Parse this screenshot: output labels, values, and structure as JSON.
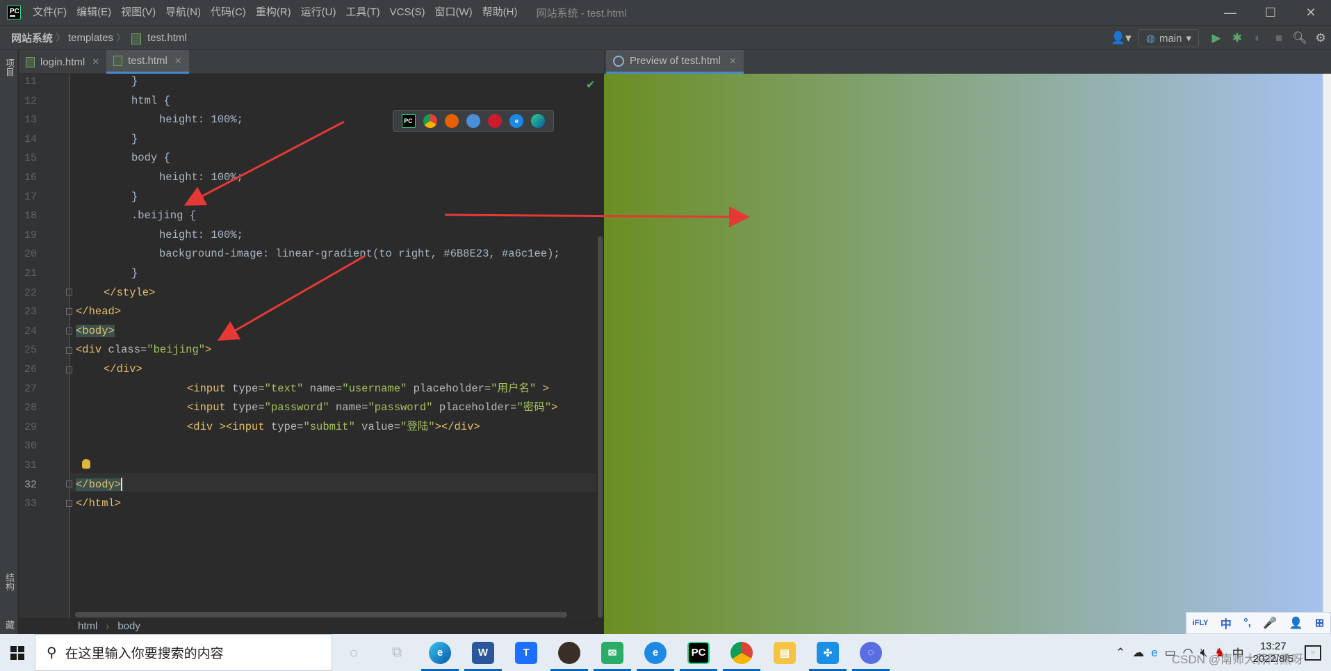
{
  "titlebar": {
    "menu": [
      "文件(F)",
      "编辑(E)",
      "视图(V)",
      "导航(N)",
      "代码(C)",
      "重构(R)",
      "运行(U)",
      "工具(T)",
      "VCS(S)",
      "窗口(W)",
      "帮助(H)"
    ],
    "window_title": "网站系统 - test.html",
    "logo_text": "PC"
  },
  "navbar": {
    "project": "网站系统",
    "folder": "templates",
    "file": "test.html",
    "run_config": "main"
  },
  "left_strip": {
    "project_label": "项目",
    "structure_label": "结构",
    "bookmarks_label": "收藏"
  },
  "editor": {
    "tabs": [
      {
        "label": "login.html",
        "active": false
      },
      {
        "label": "test.html",
        "active": true
      }
    ],
    "current_line": 32,
    "line_numbers": [
      "11",
      "12",
      "13",
      "14",
      "15",
      "16",
      "17",
      "18",
      "19",
      "20",
      "21",
      "22",
      "23",
      "24",
      "25",
      "26",
      "27",
      "28",
      "29",
      "30",
      "31",
      "32",
      "33"
    ],
    "lines": {
      "l11": "}",
      "l12": "html {",
      "l13": "height: 100%;",
      "l14": "}",
      "l15": "body {",
      "l16": "height: 100%;",
      "l17": "}",
      "l18": ".beijing {",
      "l19": "height: 100%;",
      "l20": "background-image: linear-gradient(to right, #6B8E23, #a6c1ee);",
      "l21": "}",
      "l22": "</style>",
      "l23": "</head>",
      "l24": "<body>",
      "l25_tag": "<div ",
      "l25_attr": "class=",
      "l25_val": "\"beijing\"",
      "l25_end": ">",
      "l26": "</div>",
      "l27_tag": "<input ",
      "l27_a1": "type=",
      "l27_v1": "\"text\" ",
      "l27_a2": "name=",
      "l27_v2": "\"username\" ",
      "l27_a3": "placeholder=",
      "l27_v3": "\"用户名\" ",
      "l27_end": ">",
      "l28_tag": "<input ",
      "l28_a1": "type=",
      "l28_v1": "\"password\" ",
      "l28_a2": "name=",
      "l28_v2": "\"password\" ",
      "l28_a3": "placeholder=",
      "l28_v3": "\"密码\"",
      "l28_end": ">",
      "l29_tag1": "<div >",
      "l29_tag2": "<input ",
      "l29_a1": "type=",
      "l29_v1": "\"submit\" ",
      "l29_a2": "value=",
      "l29_v2": "\"登陆\"",
      "l29_end": "></div>",
      "l32": "</body>",
      "l33": "</html>"
    },
    "browsers": [
      "PC",
      "C",
      "F",
      "S",
      "O",
      "e",
      "E"
    ],
    "bottom_crumbs": [
      "html",
      "body"
    ]
  },
  "preview": {
    "tab_label": "Preview of test.html",
    "gradient_from": "#6B8E23",
    "gradient_to": "#a6c1ee"
  },
  "ime": [
    "iFLY",
    "中",
    "°,",
    "🎤",
    "👤",
    "⊞"
  ],
  "taskbar": {
    "search_placeholder": "在这里输入你要搜索的内容",
    "time": "13:27",
    "date": "2022/8/5",
    "watermark": "CSDN @南师大蒜阿熏呀"
  },
  "colors": {
    "editor_bg": "#2b2b2b",
    "tag": "#e8bf6a",
    "string": "#a5c25c",
    "accent": "#4a88c7",
    "arrow": "#e53935"
  }
}
